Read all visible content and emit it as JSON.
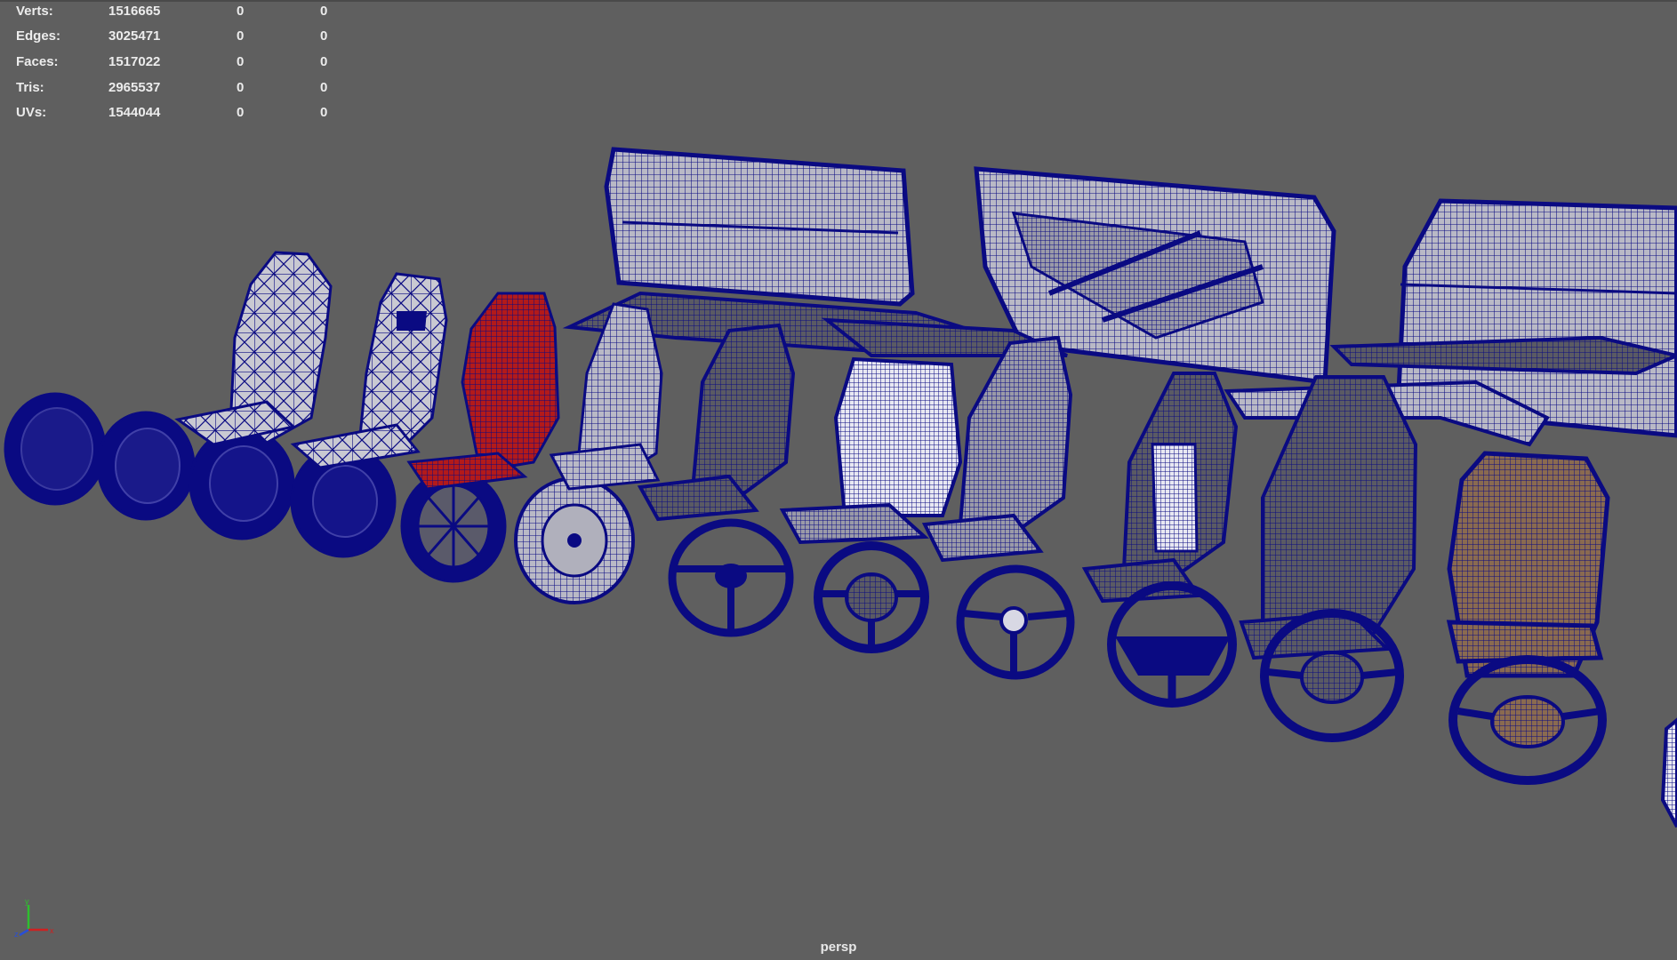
{
  "stats": [
    {
      "label": "Verts:",
      "total": "1516665",
      "selected": "0",
      "components": "0"
    },
    {
      "label": "Edges:",
      "total": "3025471",
      "selected": "0",
      "components": "0"
    },
    {
      "label": "Faces:",
      "total": "1517022",
      "selected": "0",
      "components": "0"
    },
    {
      "label": "Tris:",
      "total": "2965537",
      "selected": "0",
      "components": "0"
    },
    {
      "label": "UVs:",
      "total": "1544044",
      "selected": "0",
      "components": "0"
    }
  ],
  "camera": {
    "name": "persp"
  },
  "colors": {
    "viewport_bg": "#5f5f5f",
    "wireframe": "#0a0a82",
    "accent_red": "#b01818",
    "surface_grey": "#b8b8c4"
  },
  "axis_indicator": {
    "x": "x",
    "y": "y",
    "z": "z"
  }
}
